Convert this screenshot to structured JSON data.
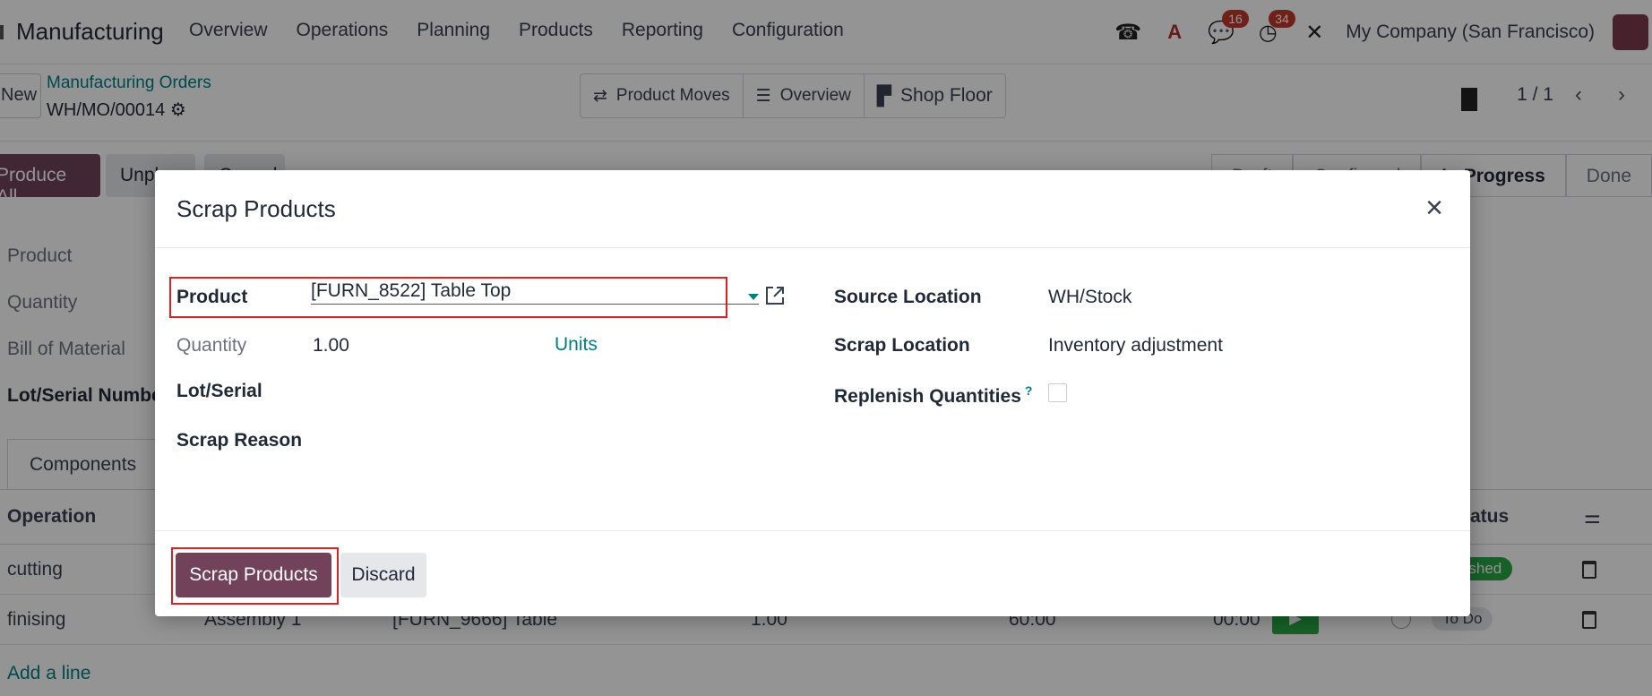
{
  "topbar": {
    "app_name": "Manufacturing",
    "menu": [
      "Overview",
      "Operations",
      "Planning",
      "Products",
      "Reporting",
      "Configuration"
    ],
    "messages_count": "16",
    "activities_count": "34",
    "company": "My Company (San Francisco)"
  },
  "controlbar": {
    "new_label": "New",
    "breadcrumb_parent": "Manufacturing Orders",
    "record_name": "WH/MO/00014",
    "smart_buttons": [
      "Product Moves",
      "Overview",
      "Shop Floor"
    ],
    "pager": "1 / 1"
  },
  "statusbar": {
    "buttons": [
      "Produce All",
      "Unplan",
      "Cancel"
    ],
    "stages": [
      "Draft",
      "Confirmed",
      "In Progress",
      "Done"
    ],
    "active_stage": "In Progress"
  },
  "form": {
    "labels": [
      "Product",
      "Quantity",
      "Bill of Material",
      "Lot/Serial Number"
    ],
    "tab": "Components",
    "table_headers": [
      "Operation",
      "Status"
    ],
    "rows": [
      {
        "operation": "cutting",
        "status": "Finished"
      },
      {
        "operation": "finising",
        "work_center": "Assembly 1",
        "product": "[FURN_9666] Table",
        "qty": "1.00",
        "expected": "60:00",
        "real": "00:00",
        "status": "To Do"
      }
    ],
    "add_line": "Add a line"
  },
  "modal": {
    "title": "Scrap Products",
    "fields": {
      "product_label": "Product",
      "product_value": "[FURN_8522] Table Top",
      "quantity_label": "Quantity",
      "quantity_value": "1.00",
      "uom_value": "Units",
      "lot_label": "Lot/Serial",
      "reason_label": "Scrap Reason",
      "source_location_label": "Source Location",
      "source_location_value": "WH/Stock",
      "scrap_location_label": "Scrap Location",
      "scrap_location_value": "Inventory adjustment",
      "replenish_label": "Replenish Quantities",
      "replenish_help": "?",
      "replenish_checked": false
    },
    "primary_button": "Scrap Products",
    "secondary_button": "Discard"
  },
  "colors": {
    "primary": "#71425a",
    "link": "#017e84",
    "highlight": "#e02020"
  }
}
